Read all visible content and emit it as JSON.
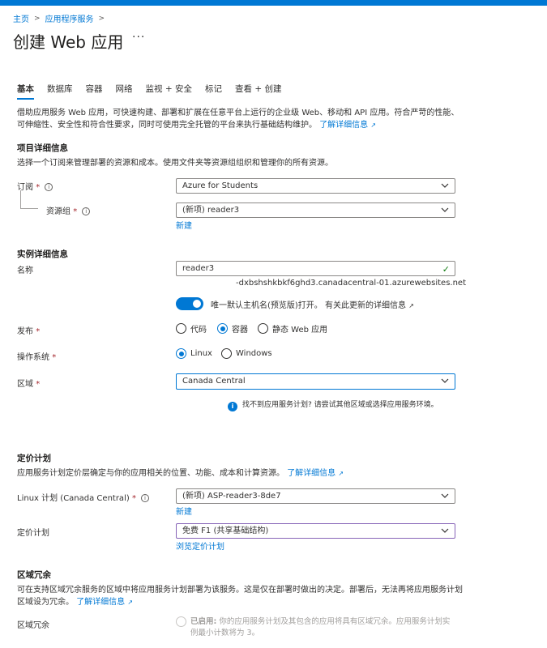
{
  "breadcrumb": {
    "home": "主页",
    "service": "应用程序服务"
  },
  "page": {
    "title": "创建 Web 应用",
    "more": "···"
  },
  "tabs": [
    "基本",
    "数据库",
    "容器",
    "网络",
    "监视 + 安全",
    "标记",
    "查看 + 创建"
  ],
  "intro": {
    "text": "借助应用服务 Web 应用，可快速构建、部署和扩展在任意平台上运行的企业级 Web、移动和 API 应用。符合严苛的性能、可伸缩性、安全性和符合性要求，同时可使用完全托管的平台来执行基础结构维护。",
    "link": "了解详细信息"
  },
  "project": {
    "heading": "项目详细信息",
    "desc": "选择一个订阅来管理部署的资源和成本。使用文件夹等资源组组织和管理你的所有资源。",
    "subscription_label": "订阅",
    "subscription_value": "Azure for Students",
    "rg_label": "资源组",
    "rg_value": "(新项) reader3",
    "rg_new": "新建"
  },
  "instance": {
    "heading": "实例详细信息",
    "name_label": "名称",
    "name_value": "reader3",
    "domain_suffix": "-dxbshshkbkf6ghd3.canadacentral-01.azurewebsites.net",
    "toggle_text": "唯一默认主机名(预览版)打开。",
    "toggle_link": "有关此更新的详细信息",
    "publish_label": "发布",
    "publish_options": [
      "代码",
      "容器",
      "静态 Web 应用"
    ],
    "os_label": "操作系统",
    "os_options": [
      "Linux",
      "Windows"
    ],
    "region_label": "区域",
    "region_value": "Canada Central",
    "region_note": "找不到应用服务计划? 请尝试其他区域或选择应用服务环境。"
  },
  "pricing": {
    "heading": "定价计划",
    "desc": "应用服务计划定价层确定与你的应用相关的位置、功能、成本和计算资源。",
    "link": "了解详细信息",
    "plan_label": "Linux 计划 (Canada Central)",
    "plan_value": "(新项) ASP-reader3-8de7",
    "plan_new": "新建",
    "tier_label": "定价计划",
    "tier_value": "免费 F1 (共享基础结构)",
    "tier_link": "浏览定价计划"
  },
  "zone": {
    "heading": "区域冗余",
    "desc": "可在支持区域冗余服务的区域中将应用服务计划部署为该服务。这是仅在部署时做出的决定。部署后，无法再将应用服务计划区域设为冗余。",
    "link": "了解详细信息",
    "label": "区域冗余",
    "option_title": "已启用:",
    "option_text": "你的应用服务计划及其包含的应用将具有区域冗余。应用服务计划实例最小计数将为 3。"
  },
  "colors": {
    "accent": "#0078d4",
    "success": "#107c10",
    "required": "#a4262c"
  }
}
